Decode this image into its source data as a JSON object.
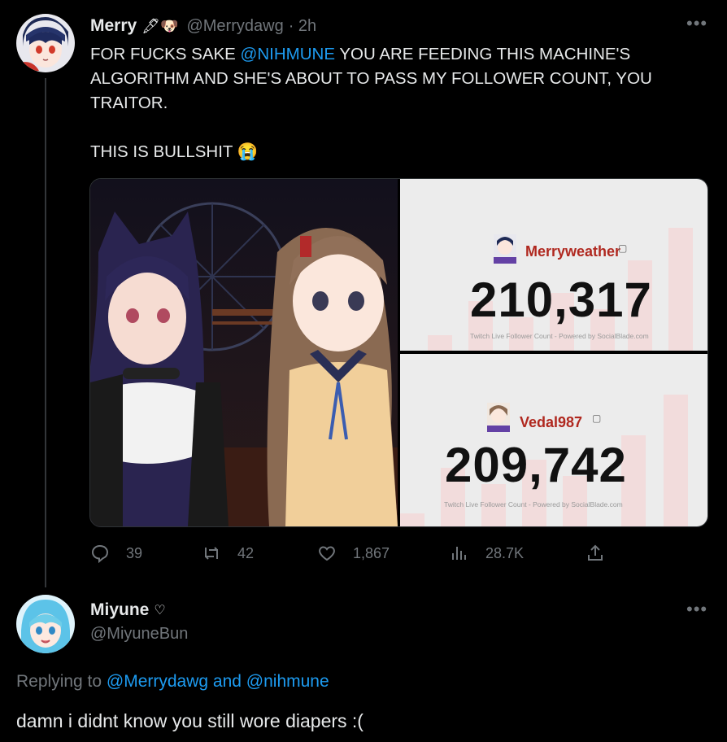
{
  "tweet": {
    "display_name": "Merry",
    "name_emojis": "🖋🐶",
    "handle": "@Merrydawg",
    "time": "· 2h",
    "text_pre": "FOR FUCKS SAKE ",
    "mention": "@NIHMUNE",
    "text_post": " YOU ARE FEEDING THIS MACHINE'S ALGORITHM AND SHE'S ABOUT TO PASS MY FOLLOWER COUNT, YOU TRAITOR.\n\nTHIS IS BULLSHIT 😭",
    "media": {
      "stat_top": {
        "channel": "Merryweather",
        "count": "210,317",
        "credit": "Twitch Live Follower Count - Powered by SocialBlade.com"
      },
      "stat_bottom": {
        "channel": "Vedal987",
        "count": "209,742",
        "credit": "Twitch Live Follower Count - Powered by SocialBlade.com"
      }
    },
    "actions": {
      "replies": "39",
      "retweets": "42",
      "likes": "1,867",
      "views": "28.7K"
    },
    "colors": {
      "accent": "#1d9bf0",
      "channel_name": "#b0281f"
    }
  },
  "reply": {
    "display_name": "Miyune",
    "name_symbol": "♡",
    "handle": "@MiyuneBun",
    "replying_label": "Replying to ",
    "replying_to": "@Merrydawg and @nihmune",
    "text": "damn i didnt know you still wore diapers :("
  },
  "icons": [
    "reply-icon",
    "retweet-icon",
    "like-icon",
    "views-icon",
    "share-icon",
    "more-icon",
    "twitch-badge-icon"
  ]
}
